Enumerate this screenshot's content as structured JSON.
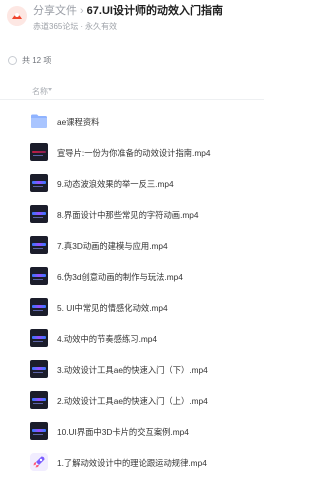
{
  "header": {
    "breadcrumb_share": "分享文件",
    "breadcrumb_separator": "›",
    "title": "67.UI设计师的动效入门指南",
    "source": "赤道365论坛",
    "dot": "·",
    "validity": "永久有效"
  },
  "list": {
    "total_label": "共 12 项",
    "column_name": "名称"
  },
  "files": [
    {
      "name": "ae课程资料",
      "type": "folder",
      "icon": "folder-icon"
    },
    {
      "name": "宣导片:一份为你准备的动效设计指南.mp4",
      "type": "video",
      "icon": "video-thumbnail-icon",
      "style": "red"
    },
    {
      "name": "9.动态波浪效果的举一反三.mp4",
      "type": "video",
      "icon": "video-thumbnail-icon",
      "style": "blue"
    },
    {
      "name": "8.界面设计中那些常见的字符动画.mp4",
      "type": "video",
      "icon": "video-thumbnail-icon",
      "style": "blue"
    },
    {
      "name": "7.真3D动画的建模与应用.mp4",
      "type": "video",
      "icon": "video-thumbnail-icon",
      "style": "blue"
    },
    {
      "name": "6.伪3d创意动画的制作与玩法.mp4",
      "type": "video",
      "icon": "video-thumbnail-icon",
      "style": "blue"
    },
    {
      "name": "5. UI中常见的情感化动效.mp4",
      "type": "video",
      "icon": "video-thumbnail-icon",
      "style": "blue"
    },
    {
      "name": "4.动效中的节奏感练习.mp4",
      "type": "video",
      "icon": "video-thumbnail-icon",
      "style": "blue"
    },
    {
      "name": "3.动效设计工具ae的快速入门（下）.mp4",
      "type": "video",
      "icon": "video-thumbnail-icon",
      "style": "blue"
    },
    {
      "name": "2.动效设计工具ae的快速入门（上）.mp4",
      "type": "video",
      "icon": "video-thumbnail-icon",
      "style": "blue"
    },
    {
      "name": "10.UI界面中3D卡片的交互案例.mp4",
      "type": "video",
      "icon": "video-thumbnail-icon",
      "style": "blue"
    },
    {
      "name": "1.了解动效设计中的理论跟运动规律.mp4",
      "type": "app",
      "icon": "rocket-app-icon",
      "style": "app"
    }
  ],
  "colors": {
    "folder": "#8fb3ff",
    "accent": "#2c7bff",
    "video_bg": "#1b1d2b"
  }
}
